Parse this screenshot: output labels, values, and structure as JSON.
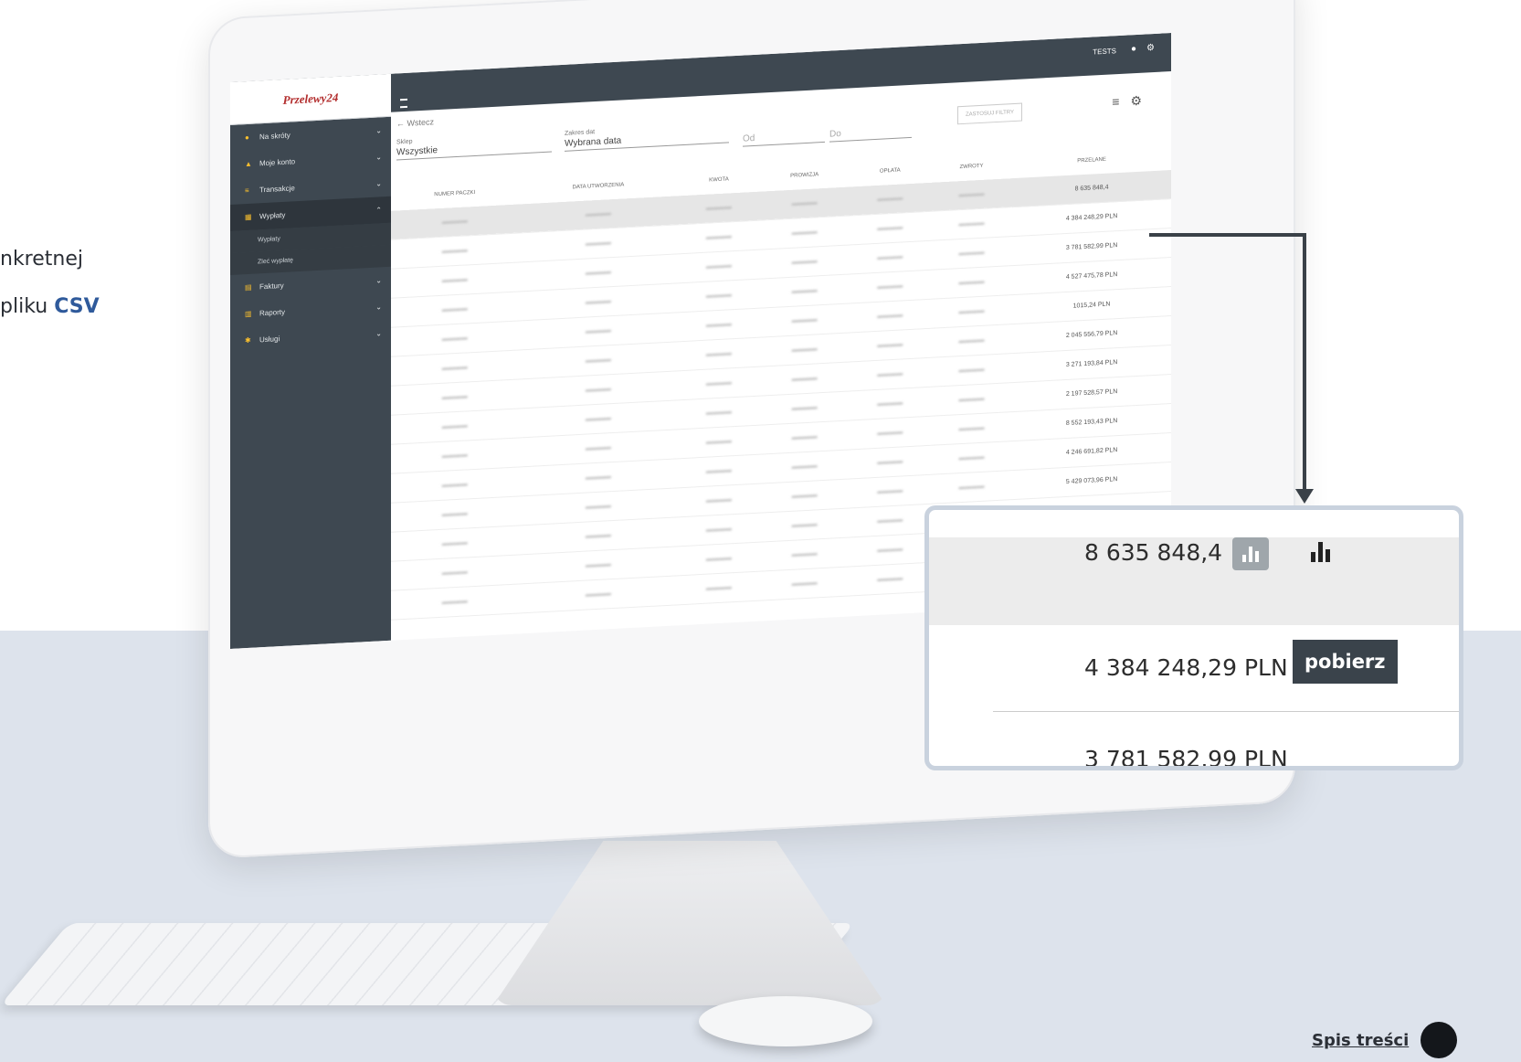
{
  "slide": {
    "text_line1": "nkretnej",
    "text_line2_prefix": "pliku ",
    "text_line2_highlight": "CSV",
    "toc_link": "Spis treści"
  },
  "app": {
    "logo_text": "Przelewy24",
    "user_label": "TESTS",
    "back_label": "Wstecz",
    "sidebar": [
      {
        "label": "Na skróty",
        "icon": "pin-icon"
      },
      {
        "label": "Moje konto",
        "icon": "user-icon"
      },
      {
        "label": "Transakcje",
        "icon": "list-icon"
      },
      {
        "label": "Wypłaty",
        "icon": "bank-icon",
        "active": true
      },
      {
        "label": "Faktury",
        "icon": "document-icon"
      },
      {
        "label": "Raporty",
        "icon": "report-icon"
      },
      {
        "label": "Usługi",
        "icon": "services-icon"
      }
    ],
    "sidebar_subitems": [
      "Wypłaty",
      "Zleć wypłatę"
    ],
    "filters": {
      "shop_label": "Sklep",
      "shop_value": "Wszystkie",
      "date_range_label": "Zakres dat",
      "date_range_value": "Wybrana data",
      "from_placeholder": "Od",
      "to_placeholder": "Do",
      "apply_button": "ZASTOSUJ FILTRY"
    },
    "table": {
      "headers": [
        "NUMER PACZKI",
        "DATA UTWORZENIA",
        "KWOTA",
        "PROWIZJA",
        "OPŁATA",
        "ZWROTY",
        "PRZELANE"
      ],
      "przelane": [
        "8 635 848,4",
        "4 384 248,29 PLN",
        "3 781 582,99 PLN",
        "4 527 475,78 PLN",
        "1015,24 PLN",
        "2 045 556,79 PLN",
        "3 271 193,84 PLN",
        "2 197 528,57 PLN",
        "8 552 193,43 PLN",
        "4 246 691,82 PLN",
        "5 429 073,96 PLN",
        "",
        "",
        ""
      ]
    }
  },
  "zoom": {
    "value1": "8 635 848,4",
    "value2": "4 384 248,29 PLN",
    "tooltip": "pobierz",
    "value3": "3 781 582,99 PLN"
  }
}
